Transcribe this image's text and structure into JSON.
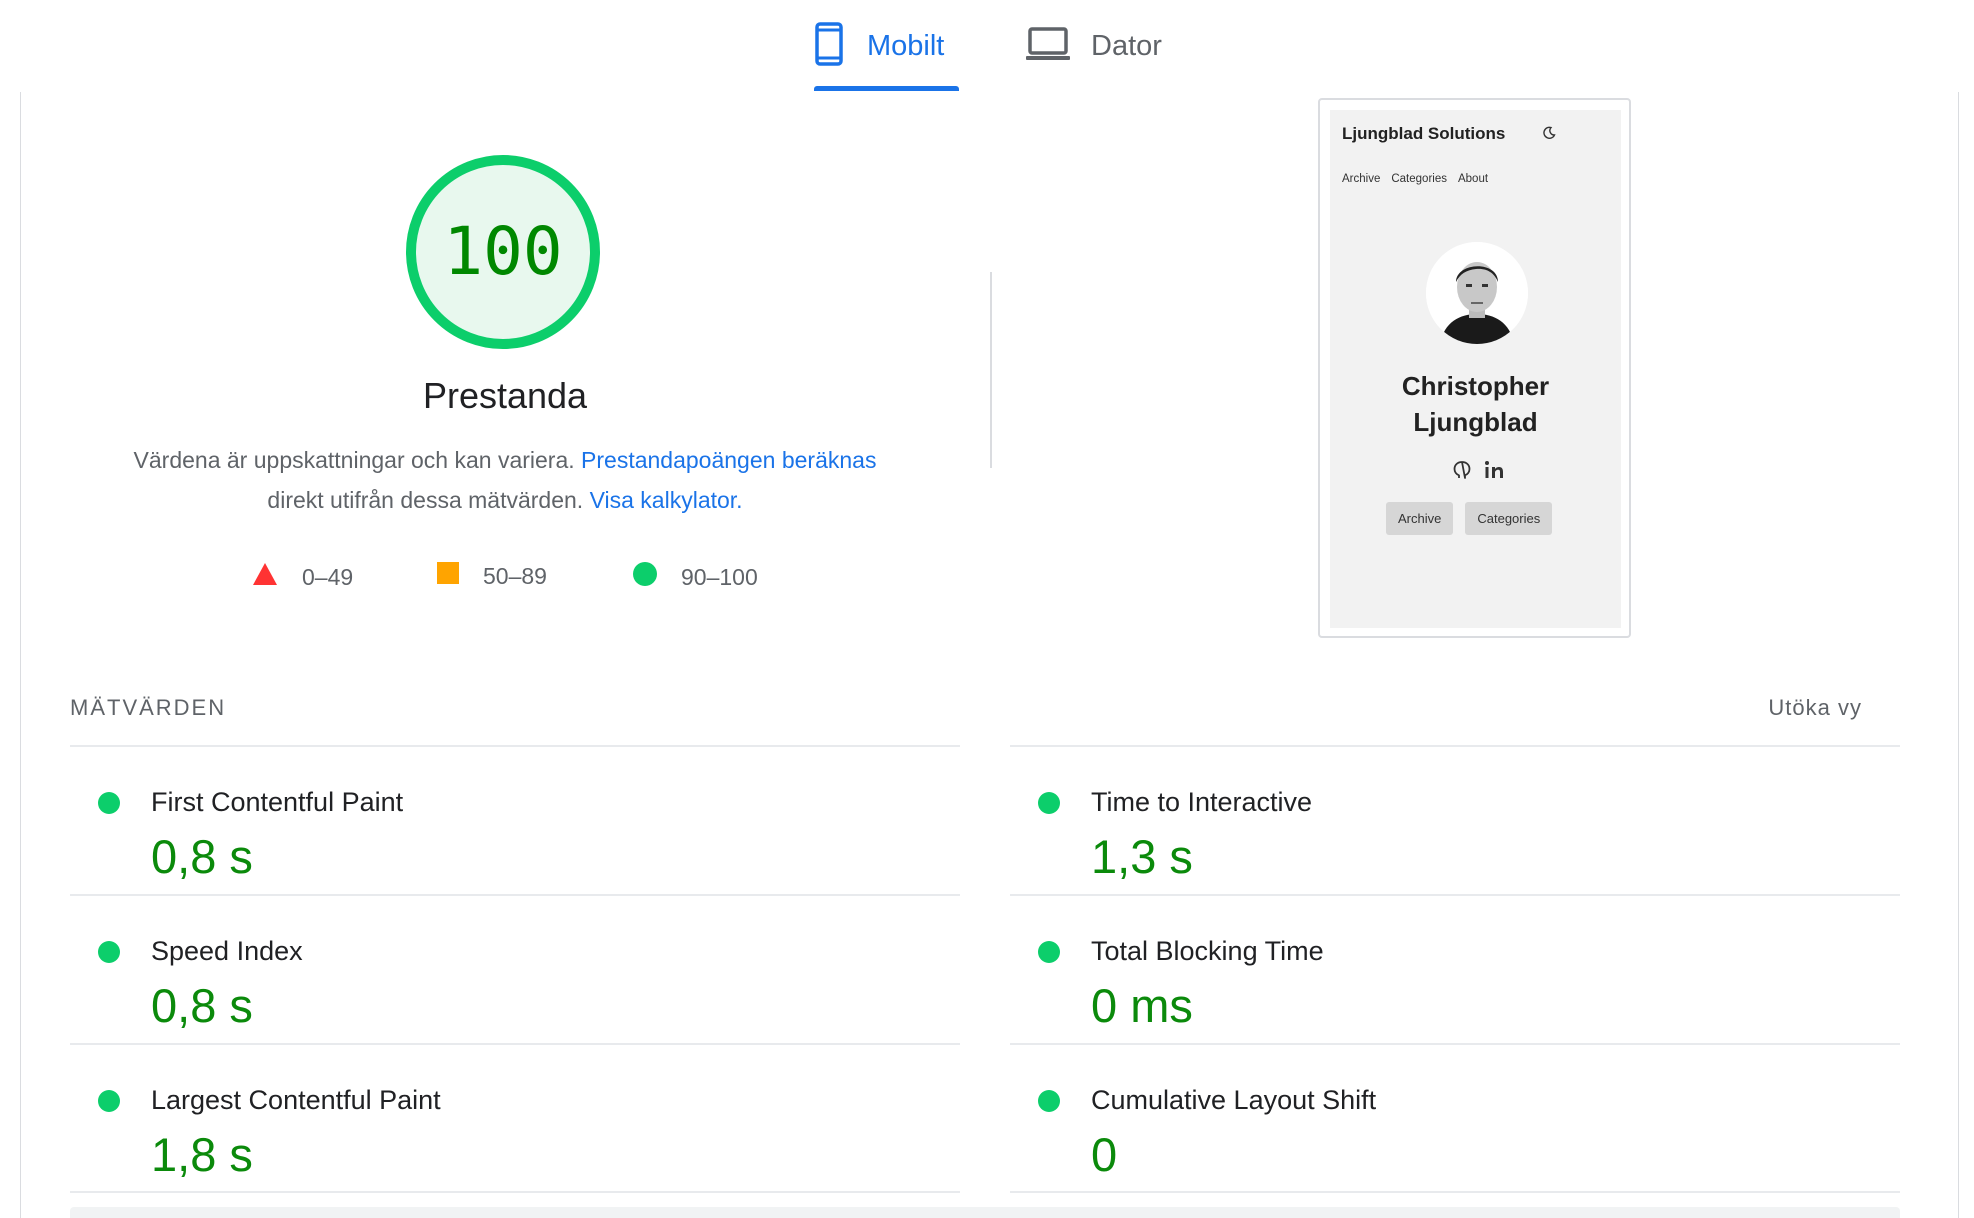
{
  "tabs": [
    {
      "label": "Mobilt",
      "icon": "phone-icon",
      "selected": true
    },
    {
      "label": "Dator",
      "icon": "laptop-icon",
      "selected": false
    }
  ],
  "score": {
    "value": "100",
    "label": "Prestanda",
    "color": "#0cce6b",
    "text_color": "#008800",
    "fill_color": "#e8f8ee"
  },
  "description": {
    "text_1": "Värdena är uppskattningar och kan variera.",
    "link_1": "Prestandapoängen beräknas",
    "text_2": "direkt utifrån dessa mätvärden.",
    "link_2": "Visa kalkylator."
  },
  "legend": [
    {
      "label": "0–49",
      "shape": "triangle",
      "color": "#ff3333"
    },
    {
      "label": "50–89",
      "shape": "square",
      "color": "#ffa400"
    },
    {
      "label": "90–100",
      "shape": "circle",
      "color": "#0cce6b"
    }
  ],
  "screenshot": {
    "site_title": "Ljungblad Solutions",
    "nav": [
      "Archive",
      "Categories",
      "About"
    ],
    "name_line1": "Christopher",
    "name_line2": "Ljungblad",
    "buttons": [
      "Archive",
      "Categories"
    ],
    "icons": [
      "moon-icon",
      "avatar",
      "github-icon",
      "linkedin-icon"
    ]
  },
  "metrics_section": {
    "header": "MÄTVÄRDEN",
    "expand": "Utöka vy"
  },
  "metrics": [
    {
      "name": "First Contentful Paint",
      "value": "0,8 s",
      "status": "pass"
    },
    {
      "name": "Time to Interactive",
      "value": "1,3 s",
      "status": "pass"
    },
    {
      "name": "Speed Index",
      "value": "0,8 s",
      "status": "pass"
    },
    {
      "name": "Total Blocking Time",
      "value": "0 ms",
      "status": "pass"
    },
    {
      "name": "Largest Contentful Paint",
      "value": "1,8 s",
      "status": "pass"
    },
    {
      "name": "Cumulative Layout Shift",
      "value": "0",
      "status": "pass"
    }
  ],
  "colors": {
    "accent": "#1a73e8",
    "pass": "#0cce6b",
    "pass_text": "#0b8a0b",
    "average": "#ffa400",
    "fail": "#ff3333"
  }
}
